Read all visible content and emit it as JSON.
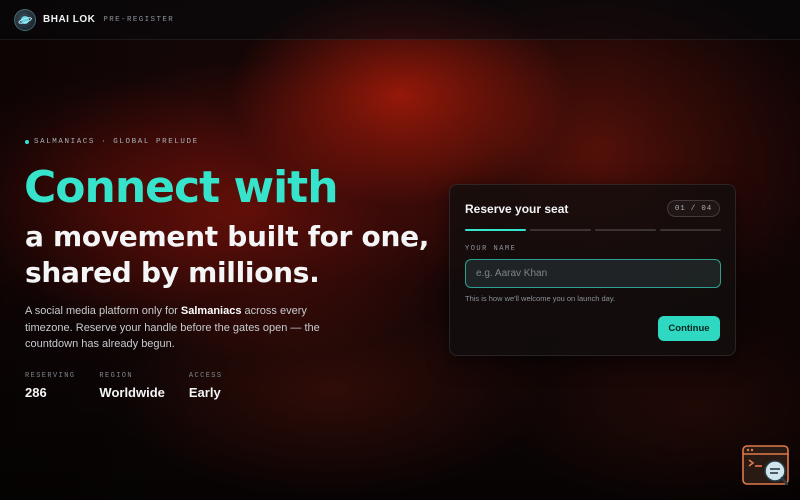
{
  "header": {
    "brand": "BHAI LOK",
    "tag": "PRE-REGISTER",
    "logo_icon": "planet-icon"
  },
  "hero": {
    "eyebrow": "SALMANIACS · GLOBAL PRELUDE",
    "headline_accent": "Connect with",
    "headline_line2": "a movement built for one,",
    "headline_line3": "shared by millions.",
    "description_before": "A social media platform only for ",
    "description_bold": "Salmaniacs",
    "description_after": " across every timezone. Reserve your handle before the gates open — the countdown has already begun."
  },
  "stats": [
    {
      "label": "RESERVING",
      "value": "286"
    },
    {
      "label": "REGION",
      "value": "Worldwide"
    },
    {
      "label": "ACCESS",
      "value": "Early"
    }
  ],
  "form": {
    "title": "Reserve your seat",
    "step_indicator": "01 / 04",
    "progress": {
      "current_step": 1,
      "total_steps": 4
    },
    "name_label": "YOUR NAME",
    "name_placeholder": "e.g. Aarav Khan",
    "name_value": "",
    "hint": "This is how we'll welcome you on launch day.",
    "continue_label": "Continue"
  },
  "floating_widget": {
    "icon": "terminal-search-icon"
  },
  "colors": {
    "accent": "#36e3cb",
    "button": "#2fd9c1",
    "background_glow": "#a01e0a",
    "widget": "#e07a4a"
  }
}
